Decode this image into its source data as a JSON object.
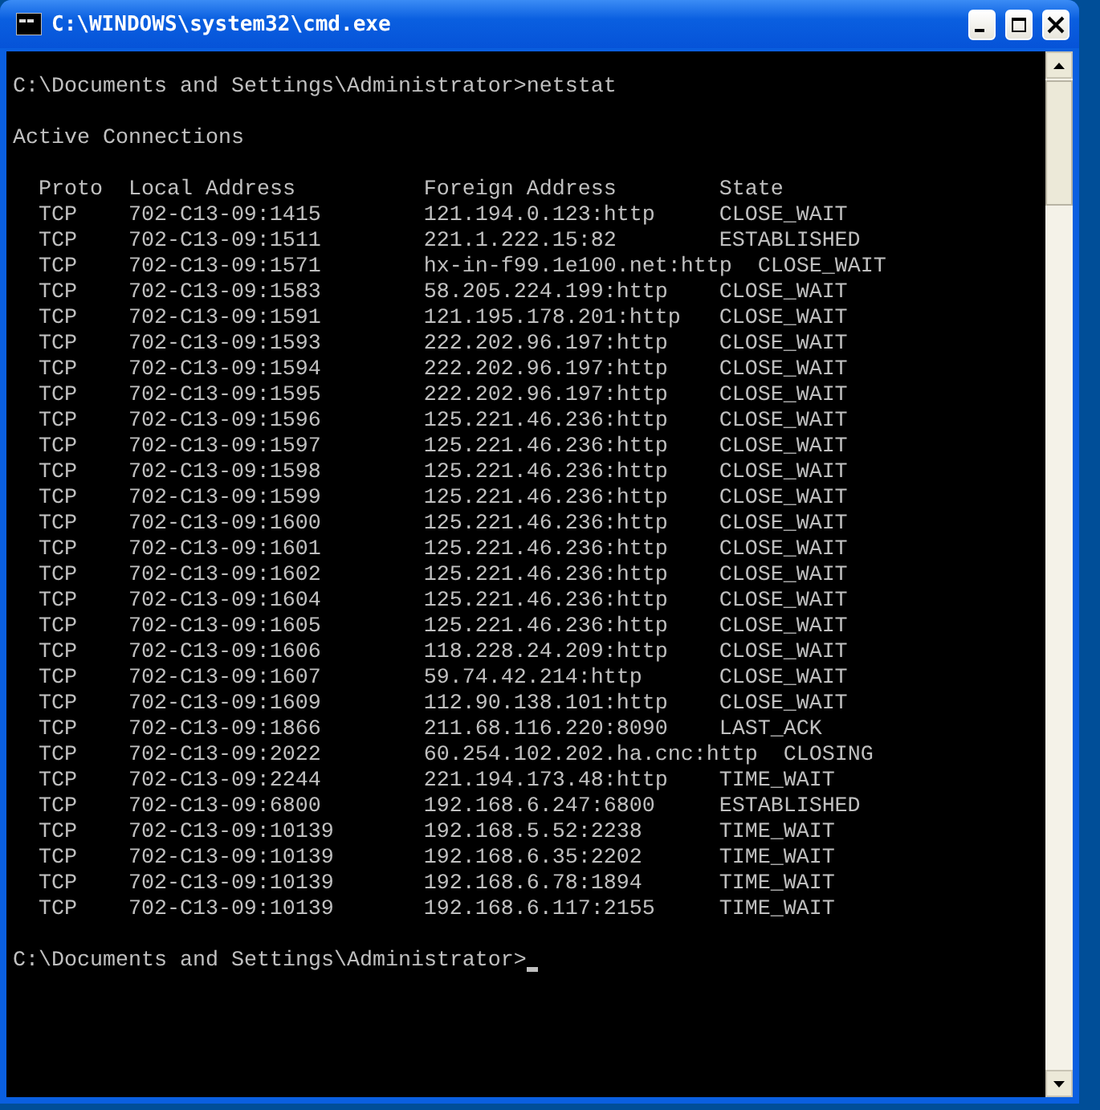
{
  "window": {
    "title": "C:\\WINDOWS\\system32\\cmd.exe"
  },
  "console": {
    "command_line": "C:\\Documents and Settings\\Administrator>netstat",
    "section_title": "Active Connections",
    "columns": [
      "Proto",
      "Local Address",
      "Foreign Address",
      "State"
    ],
    "rows": [
      {
        "proto": "TCP",
        "local_address": "702-C13-09:1415",
        "foreign_address": "121.194.0.123:http",
        "state": "CLOSE_WAIT"
      },
      {
        "proto": "TCP",
        "local_address": "702-C13-09:1511",
        "foreign_address": "221.1.222.15:82",
        "state": "ESTABLISHED"
      },
      {
        "proto": "TCP",
        "local_address": "702-C13-09:1571",
        "foreign_address": "hx-in-f99.1e100.net:http",
        "state": "CLOSE_WAIT"
      },
      {
        "proto": "TCP",
        "local_address": "702-C13-09:1583",
        "foreign_address": "58.205.224.199:http",
        "state": "CLOSE_WAIT"
      },
      {
        "proto": "TCP",
        "local_address": "702-C13-09:1591",
        "foreign_address": "121.195.178.201:http",
        "state": "CLOSE_WAIT"
      },
      {
        "proto": "TCP",
        "local_address": "702-C13-09:1593",
        "foreign_address": "222.202.96.197:http",
        "state": "CLOSE_WAIT"
      },
      {
        "proto": "TCP",
        "local_address": "702-C13-09:1594",
        "foreign_address": "222.202.96.197:http",
        "state": "CLOSE_WAIT"
      },
      {
        "proto": "TCP",
        "local_address": "702-C13-09:1595",
        "foreign_address": "222.202.96.197:http",
        "state": "CLOSE_WAIT"
      },
      {
        "proto": "TCP",
        "local_address": "702-C13-09:1596",
        "foreign_address": "125.221.46.236:http",
        "state": "CLOSE_WAIT"
      },
      {
        "proto": "TCP",
        "local_address": "702-C13-09:1597",
        "foreign_address": "125.221.46.236:http",
        "state": "CLOSE_WAIT"
      },
      {
        "proto": "TCP",
        "local_address": "702-C13-09:1598",
        "foreign_address": "125.221.46.236:http",
        "state": "CLOSE_WAIT"
      },
      {
        "proto": "TCP",
        "local_address": "702-C13-09:1599",
        "foreign_address": "125.221.46.236:http",
        "state": "CLOSE_WAIT"
      },
      {
        "proto": "TCP",
        "local_address": "702-C13-09:1600",
        "foreign_address": "125.221.46.236:http",
        "state": "CLOSE_WAIT"
      },
      {
        "proto": "TCP",
        "local_address": "702-C13-09:1601",
        "foreign_address": "125.221.46.236:http",
        "state": "CLOSE_WAIT"
      },
      {
        "proto": "TCP",
        "local_address": "702-C13-09:1602",
        "foreign_address": "125.221.46.236:http",
        "state": "CLOSE_WAIT"
      },
      {
        "proto": "TCP",
        "local_address": "702-C13-09:1604",
        "foreign_address": "125.221.46.236:http",
        "state": "CLOSE_WAIT"
      },
      {
        "proto": "TCP",
        "local_address": "702-C13-09:1605",
        "foreign_address": "125.221.46.236:http",
        "state": "CLOSE_WAIT"
      },
      {
        "proto": "TCP",
        "local_address": "702-C13-09:1606",
        "foreign_address": "118.228.24.209:http",
        "state": "CLOSE_WAIT"
      },
      {
        "proto": "TCP",
        "local_address": "702-C13-09:1607",
        "foreign_address": "59.74.42.214:http",
        "state": "CLOSE_WAIT"
      },
      {
        "proto": "TCP",
        "local_address": "702-C13-09:1609",
        "foreign_address": "112.90.138.101:http",
        "state": "CLOSE_WAIT"
      },
      {
        "proto": "TCP",
        "local_address": "702-C13-09:1866",
        "foreign_address": "211.68.116.220:8090",
        "state": "LAST_ACK"
      },
      {
        "proto": "TCP",
        "local_address": "702-C13-09:2022",
        "foreign_address": "60.254.102.202.ha.cnc:http",
        "state": "CLOSING"
      },
      {
        "proto": "TCP",
        "local_address": "702-C13-09:2244",
        "foreign_address": "221.194.173.48:http",
        "state": "TIME_WAIT"
      },
      {
        "proto": "TCP",
        "local_address": "702-C13-09:6800",
        "foreign_address": "192.168.6.247:6800",
        "state": "ESTABLISHED"
      },
      {
        "proto": "TCP",
        "local_address": "702-C13-09:10139",
        "foreign_address": "192.168.5.52:2238",
        "state": "TIME_WAIT"
      },
      {
        "proto": "TCP",
        "local_address": "702-C13-09:10139",
        "foreign_address": "192.168.6.35:2202",
        "state": "TIME_WAIT"
      },
      {
        "proto": "TCP",
        "local_address": "702-C13-09:10139",
        "foreign_address": "192.168.6.78:1894",
        "state": "TIME_WAIT"
      },
      {
        "proto": "TCP",
        "local_address": "702-C13-09:10139",
        "foreign_address": "192.168.6.117:2155",
        "state": "TIME_WAIT"
      }
    ],
    "prompt": "C:\\Documents and Settings\\Administrator>"
  }
}
